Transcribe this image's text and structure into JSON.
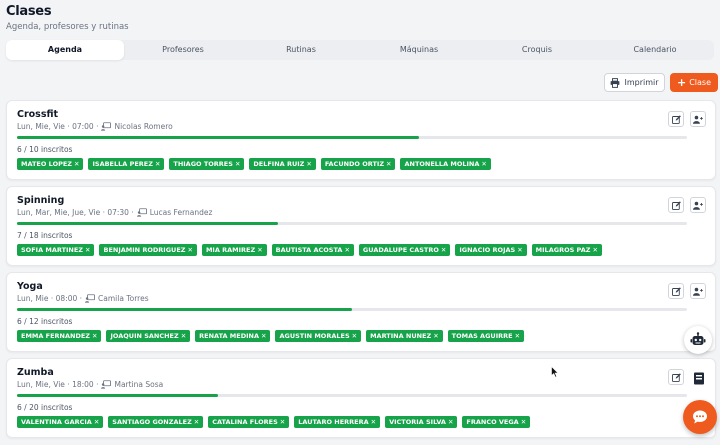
{
  "header": {
    "title": "Clases",
    "subtitle": "Agenda, profesores y rutinas"
  },
  "tabs": [
    {
      "label": "Agenda",
      "active": true
    },
    {
      "label": "Profesores",
      "active": false
    },
    {
      "label": "Rutinas",
      "active": false
    },
    {
      "label": "Máquinas",
      "active": false
    },
    {
      "label": "Croquis",
      "active": false
    },
    {
      "label": "Calendario",
      "active": false
    }
  ],
  "toolbar": {
    "print_label": "Imprimir",
    "add_class_label": "Clase"
  },
  "colors": {
    "accent": "#ef5a1e",
    "chip": "#16a34a",
    "progress": "#16a34a"
  },
  "classes": [
    {
      "name": "Crossfit",
      "schedule": "Lun, Mie, Vie · 07:00 ·",
      "teacher": "Nicolas Romero",
      "count_label": "6 / 10 inscritos",
      "enrolled": 6,
      "capacity": 10,
      "students": [
        "MATEO LOPEZ",
        "ISABELLA PEREZ",
        "THIAGO TORRES",
        "DELFINA RUIZ",
        "FACUNDO ORTIZ",
        "ANTONELLA MOLINA"
      ]
    },
    {
      "name": "Spinning",
      "schedule": "Lun, Mar, Mie, Jue, Vie · 07:30 ·",
      "teacher": "Lucas Fernandez",
      "count_label": "7 / 18 inscritos",
      "enrolled": 7,
      "capacity": 18,
      "students": [
        "SOFIA MARTINEZ",
        "BENJAMIN RODRIGUEZ",
        "MIA RAMIREZ",
        "BAUTISTA ACOSTA",
        "GUADALUPE CASTRO",
        "IGNACIO ROJAS",
        "MILAGROS PAZ"
      ]
    },
    {
      "name": "Yoga",
      "schedule": "Lun, Mie · 08:00 ·",
      "teacher": "Camila Torres",
      "count_label": "6 / 12 inscritos",
      "enrolled": 6,
      "capacity": 12,
      "students": [
        "EMMA FERNANDEZ",
        "JOAQUIN SANCHEZ",
        "RENATA MEDINA",
        "AGUSTIN MORALES",
        "MARTINA NUNEZ",
        "TOMAS AGUIRRE"
      ]
    },
    {
      "name": "Zumba",
      "schedule": "Lun, Mie, Vie · 18:00 ·",
      "teacher": "Martina Sosa",
      "count_label": "6 / 20 inscritos",
      "enrolled": 6,
      "capacity": 20,
      "students": [
        "VALENTINA GARCIA",
        "SANTIAGO GONZALEZ",
        "CATALINA FLORES",
        "LAUTARO HERRERA",
        "VICTORIA SILVA",
        "FRANCO VEGA"
      ]
    }
  ],
  "icons": {
    "print": "printer-icon",
    "add": "plus-icon",
    "teacher": "teacher-icon",
    "edit": "edit-icon",
    "add_user": "add-user-icon",
    "remove": "close-icon",
    "assistant": "robot-icon",
    "chat": "chat-icon",
    "notebook": "notebook-icon"
  },
  "chip_remove_glyph": "✕"
}
